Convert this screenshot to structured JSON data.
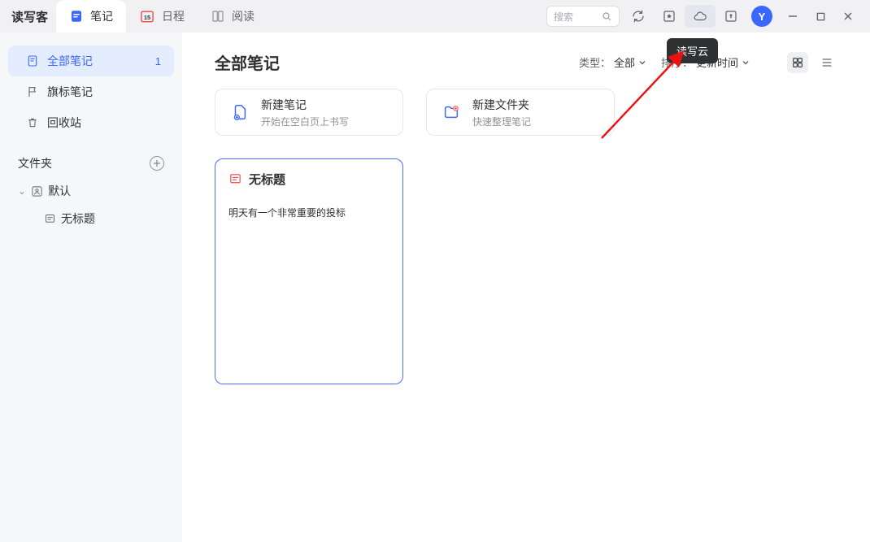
{
  "app": {
    "name": "读写客"
  },
  "top_tabs": [
    {
      "label": "笔记",
      "icon": "note"
    },
    {
      "label": "日程",
      "icon": "calendar",
      "badge": "15"
    },
    {
      "label": "阅读",
      "icon": "reader"
    }
  ],
  "search": {
    "placeholder": "搜索"
  },
  "avatar": {
    "letter": "Y"
  },
  "tooltip": {
    "text": "读写云"
  },
  "sidebar": {
    "items": [
      {
        "label": "全部笔记",
        "icon": "doc",
        "count": "1"
      },
      {
        "label": "旗标笔记",
        "icon": "flag"
      },
      {
        "label": "回收站",
        "icon": "trash"
      }
    ],
    "folder_section": {
      "label": "文件夹"
    },
    "tree": {
      "root": {
        "label": "默认"
      },
      "child": {
        "label": "无标题"
      }
    }
  },
  "main": {
    "title": "全部笔记",
    "filter_type": {
      "label": "类型：",
      "value": "全部"
    },
    "filter_sort": {
      "label": "排序：",
      "value": "更新时间"
    },
    "new_note": {
      "title": "新建笔记",
      "sub": "开始在空白页上书写"
    },
    "new_folder": {
      "title": "新建文件夹",
      "sub": "快速整理笔记"
    }
  },
  "note": {
    "title": "无标题",
    "body": "明天有一个非常重要的投标"
  }
}
